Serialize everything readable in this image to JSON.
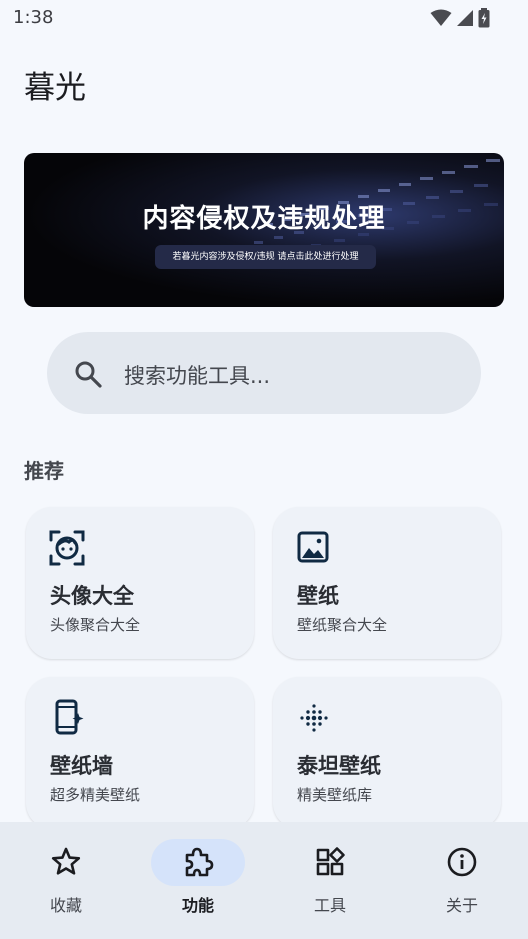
{
  "status_bar": {
    "time": "1:38"
  },
  "app": {
    "title": "暮光"
  },
  "banner": {
    "title": "内容侵权及违规处理",
    "subtitle": "若暮光内容涉及侵权/违规 请点击此处进行处理"
  },
  "search": {
    "placeholder": "搜索功能工具..."
  },
  "recommend": {
    "title": "推荐",
    "cards": [
      {
        "title": "头像大全",
        "subtitle": "头像聚合大全",
        "icon": "face-scan-icon"
      },
      {
        "title": "壁纸",
        "subtitle": "壁纸聚合大全",
        "icon": "image-icon"
      },
      {
        "title": "壁纸墙",
        "subtitle": "超多精美壁纸",
        "icon": "phone-sparkle-icon"
      },
      {
        "title": "泰坦壁纸",
        "subtitle": "精美壁纸库",
        "icon": "dots-grid-icon"
      }
    ]
  },
  "bottom_nav": {
    "active_index": 1,
    "items": [
      {
        "label": "收藏",
        "icon": "star-icon"
      },
      {
        "label": "功能",
        "icon": "puzzle-icon"
      },
      {
        "label": "工具",
        "icon": "widgets-icon"
      },
      {
        "label": "关于",
        "icon": "info-icon"
      }
    ]
  },
  "colors": {
    "background": "#f5f8fd",
    "search_bg": "#e3e8ef",
    "card_bg": "#eef2f8",
    "nav_bg": "#e6ebf2",
    "nav_active_pill": "#d5e3fa",
    "icon_dark": "#102a43"
  }
}
